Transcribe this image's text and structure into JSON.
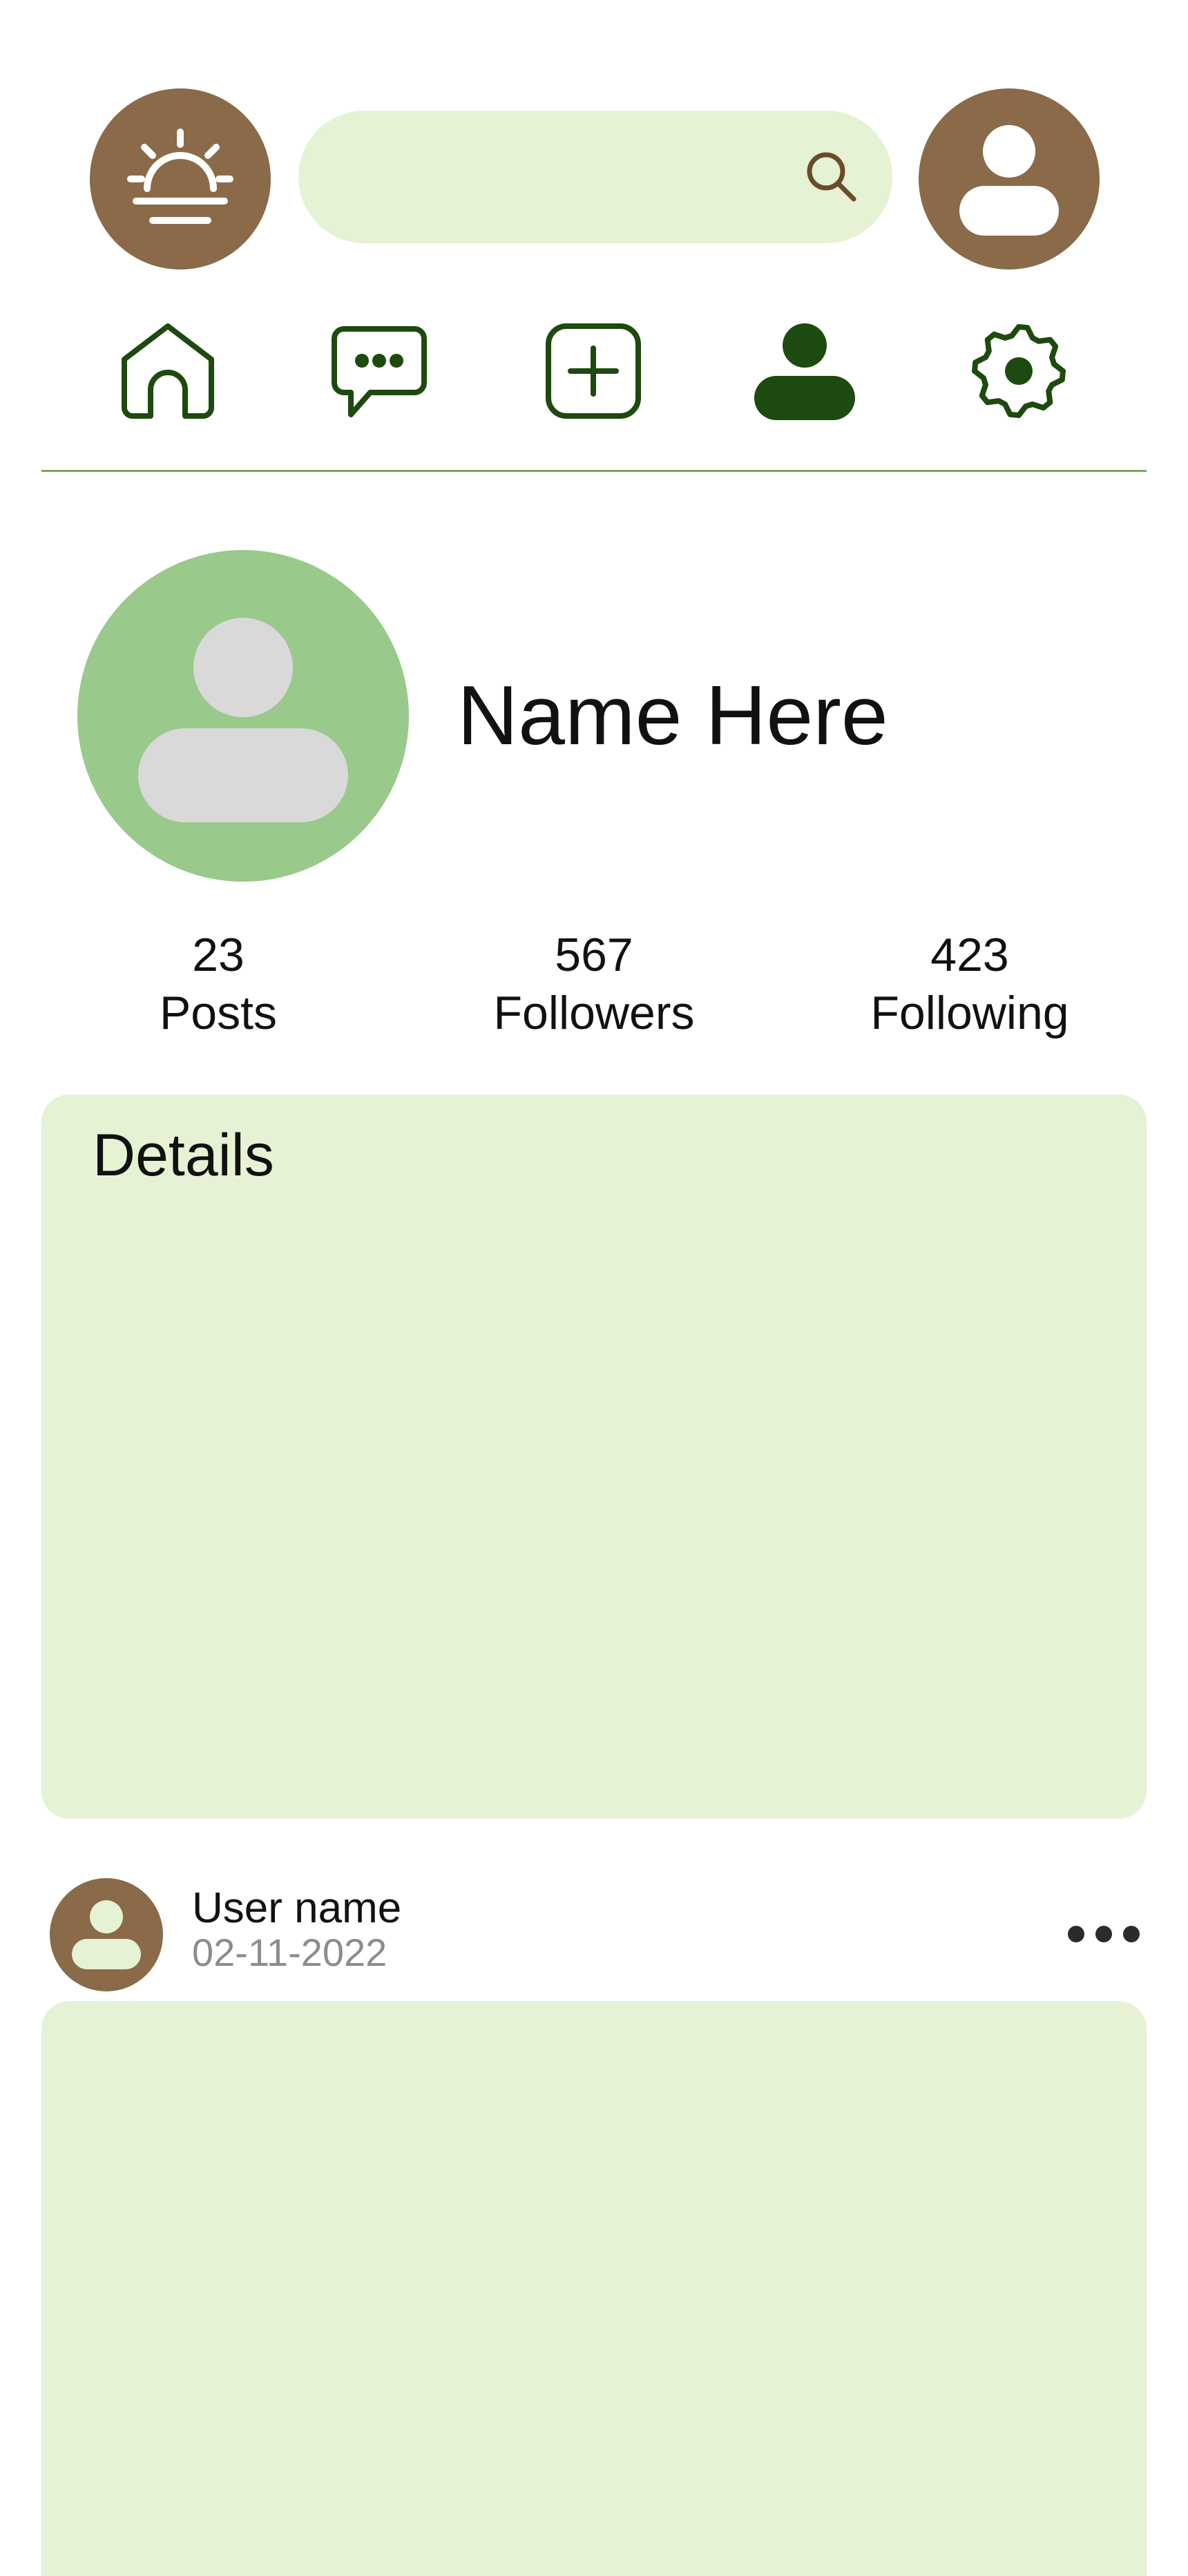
{
  "colors": {
    "brown": "#8a6a48",
    "light_green": "#e5f2d4",
    "avatar_green": "#99c98b",
    "avatar_placeholder": "#d9d9d9",
    "dark_green": "#1d4a0e",
    "divider": "#7aa85a",
    "muted_text": "#8c8c8c",
    "icon_white": "#ffffff",
    "dots": "#2b2b2b"
  },
  "header": {
    "logo_icon": "sunrise-icon",
    "search": {
      "value": "",
      "placeholder": "",
      "icon": "search-icon"
    },
    "account_icon": "user-icon"
  },
  "nav": {
    "items": [
      {
        "name": "home",
        "icon": "home-icon",
        "active": false
      },
      {
        "name": "messages",
        "icon": "chat-bubble-icon",
        "active": false
      },
      {
        "name": "create",
        "icon": "plus-square-icon",
        "active": false
      },
      {
        "name": "profile",
        "icon": "person-icon",
        "active": true
      },
      {
        "name": "settings",
        "icon": "gear-icon",
        "active": false
      }
    ]
  },
  "profile": {
    "name": "Name Here",
    "stats": [
      {
        "value": "23",
        "label": "Posts"
      },
      {
        "value": "567",
        "label": "Followers"
      },
      {
        "value": "423",
        "label": "Following"
      }
    ]
  },
  "details": {
    "title": "Details"
  },
  "post": {
    "username": "User name",
    "date": "02-11-2022",
    "more_icon": "more-horizontal-icon"
  }
}
